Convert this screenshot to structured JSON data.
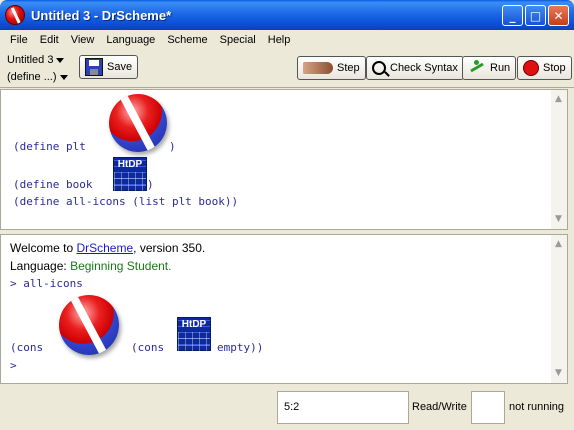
{
  "window": {
    "title": "Untitled 3 - DrScheme*"
  },
  "menubar": [
    "File",
    "Edit",
    "View",
    "Language",
    "Scheme",
    "Special",
    "Help"
  ],
  "toolbar": {
    "file_select": "Untitled 3",
    "define_select": "(define ...)",
    "save_label": "Save",
    "step_label": "Step",
    "check_syntax_label": "Check Syntax",
    "run_label": "Run",
    "stop_label": "Stop"
  },
  "editor": {
    "line1_prefix": "(define plt ",
    "line1_suffix": ")",
    "line2_prefix": "(define book ",
    "line2_suffix": ")",
    "line3": "(define all-icons (list plt book))"
  },
  "interactions": {
    "welcome_prefix": "Welcome to ",
    "welcome_link": "DrScheme",
    "welcome_suffix": ", version 350.",
    "language_prefix": "Language: ",
    "language_value": "Beginning Student",
    "language_suffix": ".",
    "prompt_line": "> all-icons",
    "cons1": "(cons ",
    "cons2": "(cons ",
    "tail": "empty))",
    "prompt": ">"
  },
  "images": {
    "htdp_text": "HtDP"
  },
  "statusbar": {
    "position": "5:2",
    "mode": "Read/Write",
    "run_state": "not running"
  }
}
